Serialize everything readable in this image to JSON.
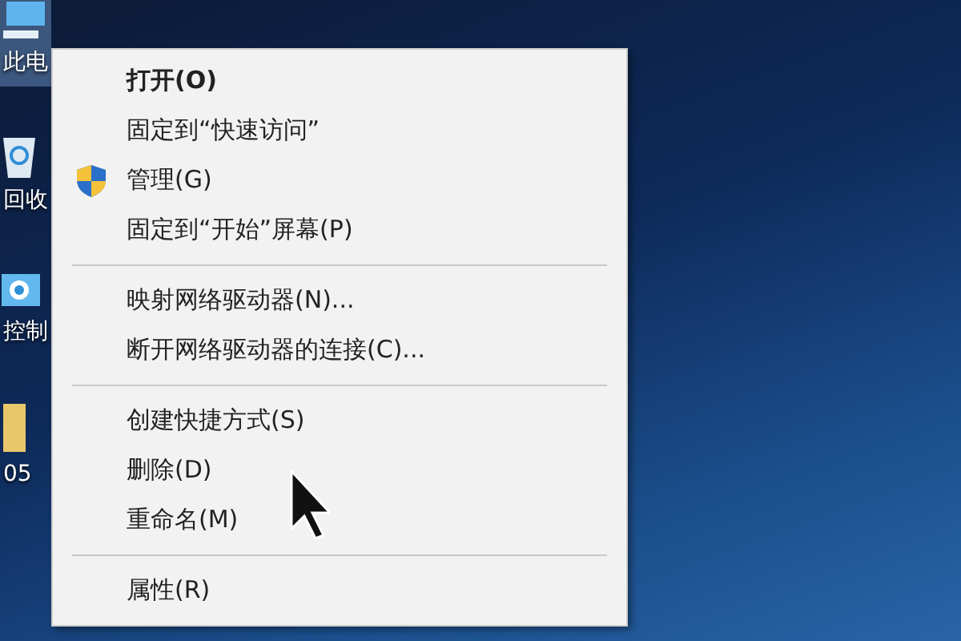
{
  "desktop_icons": [
    {
      "kind": "computer",
      "label": "此电",
      "selected": true
    },
    {
      "kind": "recycle",
      "label": "回收",
      "selected": false
    },
    {
      "kind": "control",
      "label": "控制",
      "selected": false
    },
    {
      "kind": "folder",
      "label": "05",
      "selected": false
    }
  ],
  "context_menu": {
    "items": [
      {
        "kind": "item",
        "label": "打开(O)",
        "default": true,
        "shield": false
      },
      {
        "kind": "item",
        "label": "固定到“快速访问”",
        "default": false,
        "shield": false
      },
      {
        "kind": "item",
        "label": "管理(G)",
        "default": false,
        "shield": true
      },
      {
        "kind": "item",
        "label": "固定到“开始”屏幕(P)",
        "default": false,
        "shield": false
      },
      {
        "kind": "separator"
      },
      {
        "kind": "item",
        "label": "映射网络驱动器(N)...",
        "default": false,
        "shield": false
      },
      {
        "kind": "item",
        "label": "断开网络驱动器的连接(C)...",
        "default": false,
        "shield": false
      },
      {
        "kind": "separator"
      },
      {
        "kind": "item",
        "label": "创建快捷方式(S)",
        "default": false,
        "shield": false
      },
      {
        "kind": "item",
        "label": "删除(D)",
        "default": false,
        "shield": false
      },
      {
        "kind": "item",
        "label": "重命名(M)",
        "default": false,
        "shield": false
      },
      {
        "kind": "separator"
      },
      {
        "kind": "item",
        "label": "属性(R)",
        "default": false,
        "shield": false
      }
    ]
  }
}
